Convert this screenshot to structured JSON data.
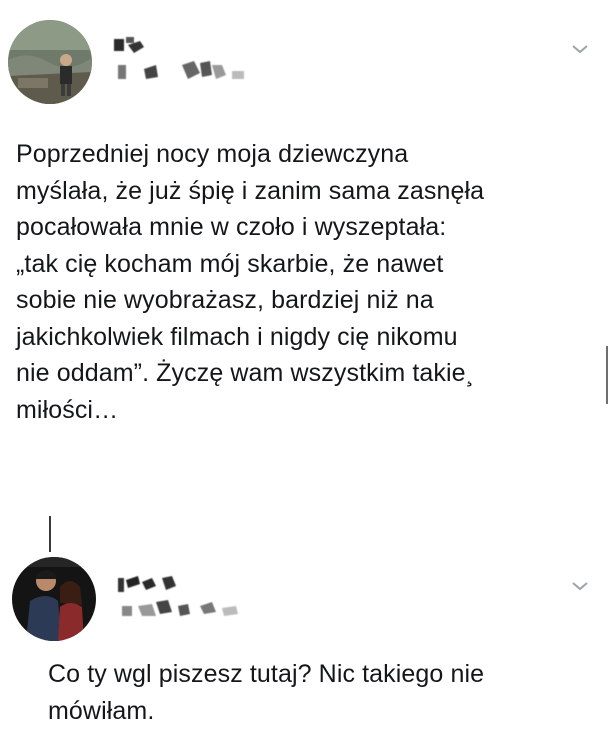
{
  "tweet1": {
    "text": "Poprzedniej nocy moja dziewczyna\nmyślała, że już śpię i zanim sama zasnęła\npocałowała mnie w czoło i wyszeptała:\n„tak cię kocham mój skarbie, że nawet\nsobie nie wyobrażasz, bardziej niż na\njakichkolwiek filmach i nigdy cię nikomu\nnie oddam”. Życzę wam wszystkim takie¸\nmiłości…"
  },
  "tweet2": {
    "text": "Co ty wgl piszesz tutaj? Nic takiego nie\nmówiłam."
  },
  "colors": {
    "text": "#14171a",
    "chevron": "#9aa4ad"
  }
}
